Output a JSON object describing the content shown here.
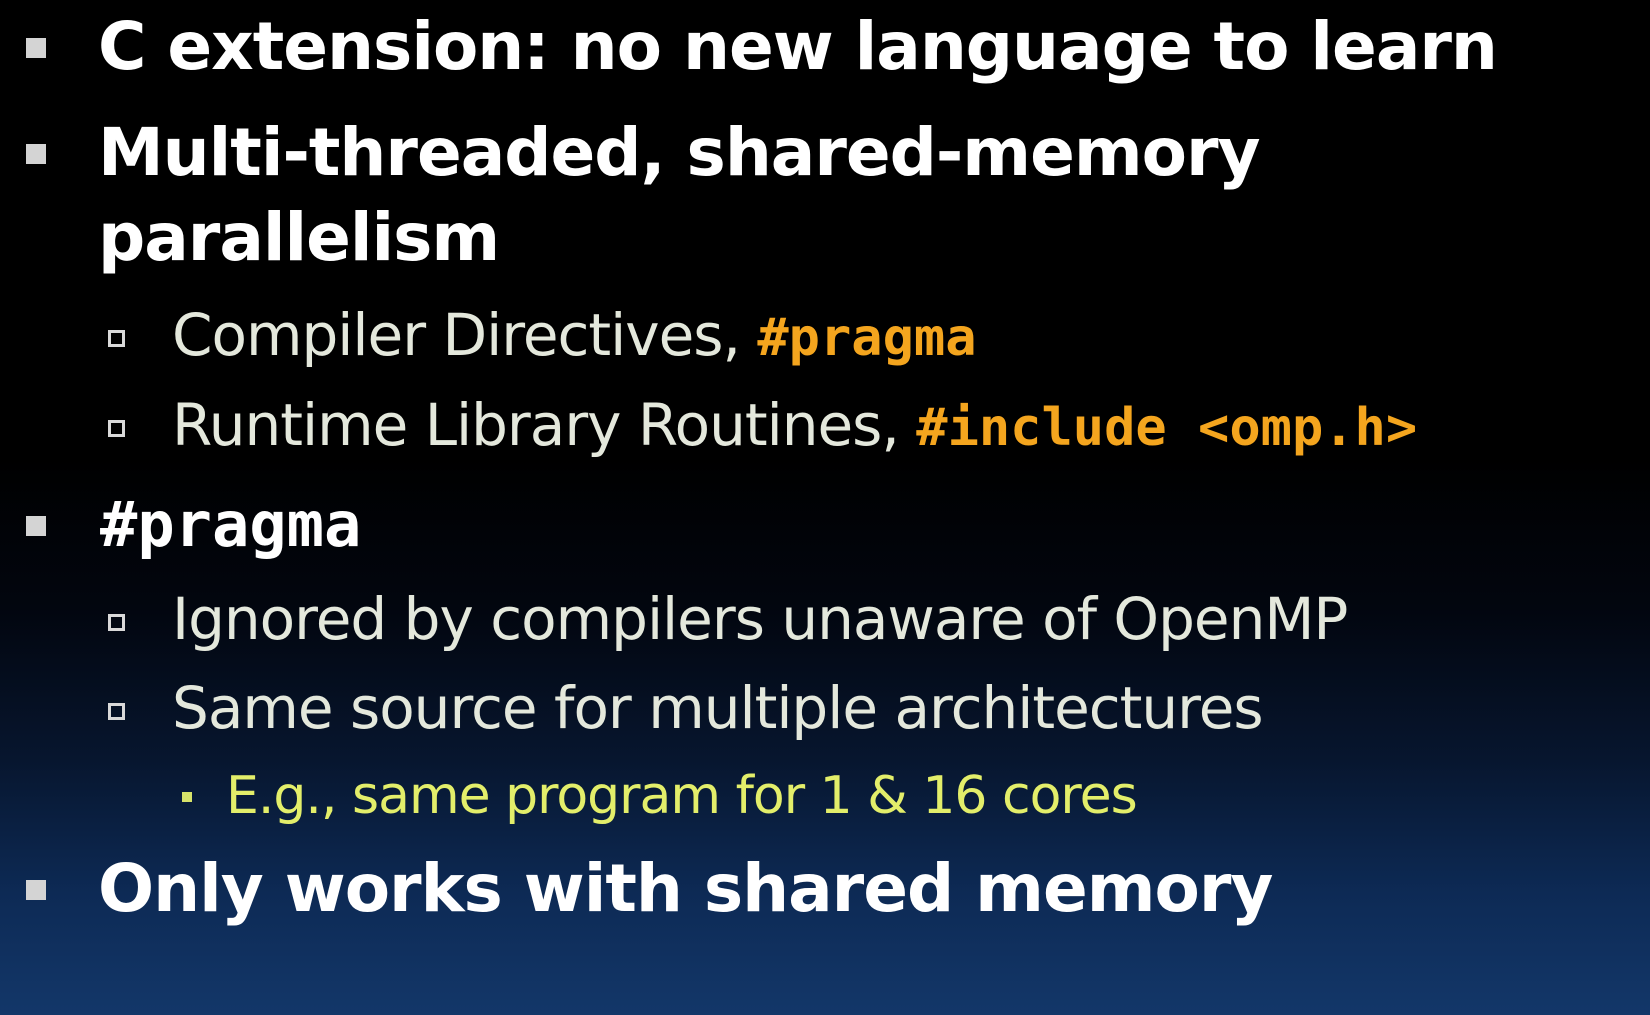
{
  "slide": {
    "bullets": {
      "c_extension": "C extension: no new language to learn",
      "multithreaded_line1": "Multi-threaded, shared-memory",
      "multithreaded_line2": "parallelism",
      "compiler_directives_text": "Compiler Directives, ",
      "compiler_directives_code": "#pragma",
      "runtime_library_text": "Runtime Library Routines, ",
      "runtime_library_code": "#include <omp.h>",
      "pragma_heading": "#pragma",
      "ignored_by_compilers": "Ignored by compilers unaware of OpenMP",
      "same_source": "Same source for multiple architectures",
      "example_cores": "E.g., same program for 1 & 16 cores",
      "only_shared_memory": "Only works with shared memory"
    }
  },
  "colors": {
    "background_top": "#000000",
    "background_bottom": "#133769",
    "level1_text": "#ffffff",
    "level2_text": "#e4e8dc",
    "level3_text": "#e3ee6a",
    "code_accent": "#f4a51e"
  }
}
